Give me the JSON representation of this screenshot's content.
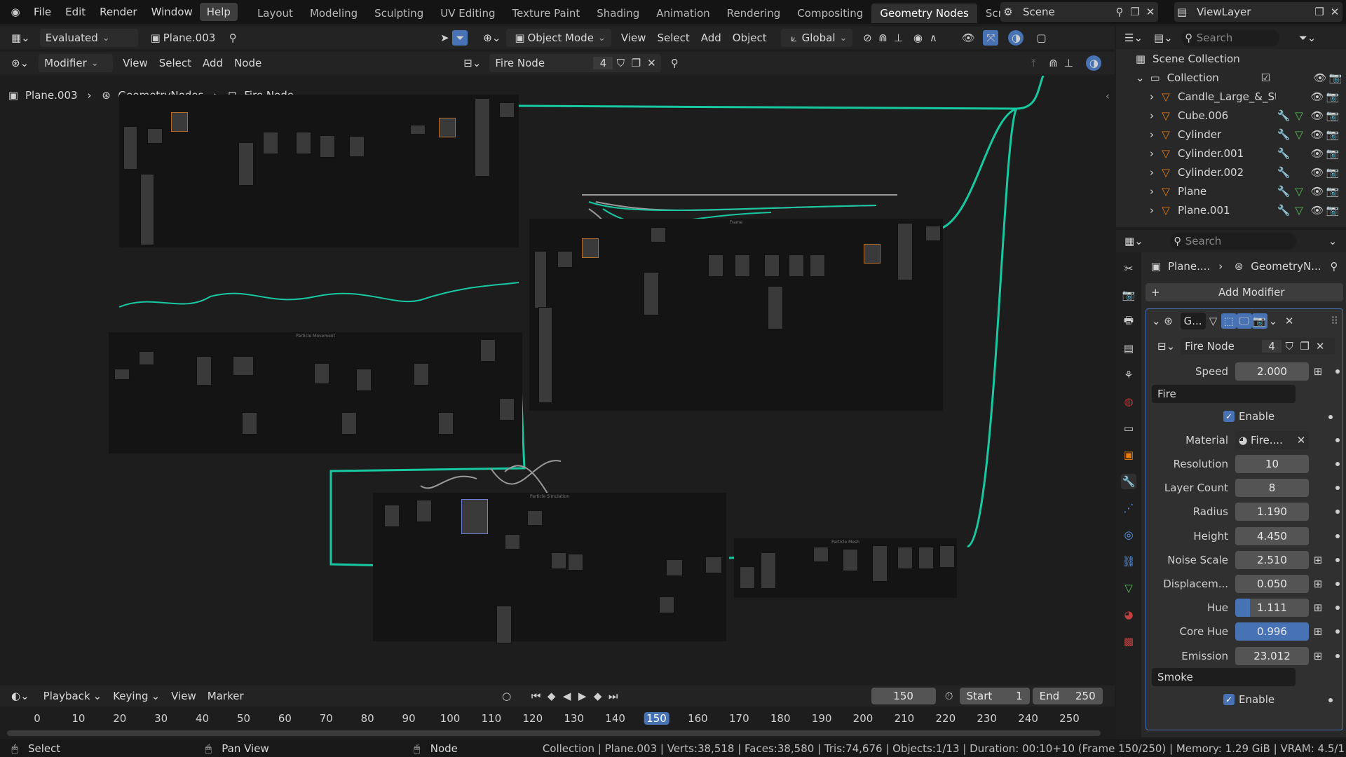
{
  "topbar": {
    "menus": [
      "File",
      "Edit",
      "Render",
      "Window",
      "Help"
    ],
    "workspaces": [
      "Layout",
      "Modeling",
      "Sculpting",
      "UV Editing",
      "Texture Paint",
      "Shading",
      "Animation",
      "Rendering",
      "Compositing",
      "Geometry Nodes",
      "Scripting"
    ],
    "active_workspace": "Geometry Nodes",
    "add_workspace": "+",
    "scene": "Scene",
    "view_layer": "ViewLayer"
  },
  "node_editor": {
    "header1": {
      "evaluated": "Evaluated",
      "object": "Plane.003",
      "mode": "Object Mode",
      "menus": [
        "View",
        "Select",
        "Add",
        "Object"
      ],
      "transform": "Global"
    },
    "header2": {
      "menus": [
        "Modifier",
        "View",
        "Select",
        "Add",
        "Node"
      ],
      "tree_name": "Fire Node",
      "users": "4"
    },
    "breadcrumb": [
      "Plane.003",
      "GeometryNodes",
      "Fire Node"
    ],
    "frame_titles": [
      "Frame",
      "Particle Movement",
      "Particle Simulation",
      "Particle Mesh"
    ]
  },
  "timeline": {
    "menus": [
      "Playback",
      "Keying",
      "View",
      "Marker"
    ],
    "current_frame": "150",
    "start_label": "Start",
    "start": "1",
    "end_label": "End",
    "end": "250",
    "ticks": [
      "0",
      "10",
      "20",
      "30",
      "40",
      "50",
      "60",
      "70",
      "80",
      "90",
      "100",
      "110",
      "120",
      "130",
      "140",
      "150",
      "160",
      "170",
      "180",
      "190",
      "200",
      "210",
      "220",
      "230",
      "240",
      "250"
    ]
  },
  "statusbar": {
    "select": "Select",
    "pan": "Pan View",
    "node": "Node",
    "stats": "Collection | Plane.003 | Verts:38,518 | Faces:38,580 | Tris:74,676 | Objects:1/13 | Duration: 00:10+10 (Frame 150/250) | Memory: 1.29 GiB | VRAM: 4.5/1"
  },
  "outliner": {
    "search_placeholder": "Search",
    "root": "Scene Collection",
    "collection": "Collection",
    "items": [
      "Candle_Large_&_Stan",
      "Cube.006",
      "Cylinder",
      "Cylinder.001",
      "Cylinder.002",
      "Plane",
      "Plane.001"
    ]
  },
  "properties": {
    "search_placeholder": "Search",
    "breadcrumb": [
      "Plane....",
      "GeometryN..."
    ],
    "add_modifier": "Add Modifier",
    "modifier_name": "G...",
    "tree_name": "Fire Node",
    "users": "4",
    "params": [
      {
        "label": "Speed",
        "value": "2.000"
      },
      {
        "label": "Resolution",
        "value": "10"
      },
      {
        "label": "Layer Count",
        "value": "8"
      },
      {
        "label": "Radius",
        "value": "1.190"
      },
      {
        "label": "Height",
        "value": "4.450"
      },
      {
        "label": "Noise Scale",
        "value": "2.510"
      },
      {
        "label": "Displacem...",
        "value": "0.050"
      },
      {
        "label": "Hue",
        "value": "1.111"
      },
      {
        "label": "Core Hue",
        "value": "0.996"
      },
      {
        "label": "Emission",
        "value": "23.012"
      }
    ],
    "panel_fire": "Fire",
    "enable": "Enable",
    "material_label": "Material",
    "material_value": "Fire....",
    "panel_smoke": "Smoke",
    "enable2": "Enable"
  },
  "colors": {
    "accent": "#4772b3",
    "link": "#18c8a0",
    "bg": "#1d1d1d"
  }
}
